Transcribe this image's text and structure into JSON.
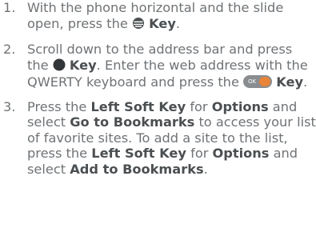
{
  "steps": [
    {
      "number": "1.",
      "parts": {
        "t1": "With the phone horizontal and the slide open, press the ",
        "k1": "Key",
        "t2": "."
      },
      "icon": "browser-globe-icon"
    },
    {
      "number": "2.",
      "parts": {
        "t1": "Scroll down to the address bar and press the ",
        "k1": "Key",
        "t2": ". Enter the web address with the QWERTY keyboard and press the ",
        "k2": "Key",
        "t3": "."
      },
      "icons": [
        "center-select-key-icon",
        "ok-enter-key-icon"
      ],
      "ok_key_text": "OK"
    },
    {
      "number": "3.",
      "parts": {
        "t1": "Press the ",
        "b1": "Left Soft Key",
        "t2": " for ",
        "b2": "Options",
        "t3": " and select ",
        "b3": "Go to Bookmarks",
        "t4": " to access your list of favorite sites. To add a site to the list, press the ",
        "b4": "Left Soft Key",
        "t5": " for ",
        "b5": "Options",
        "t6": " and select ",
        "b6": "Add to Bookmarks",
        "t7": "."
      }
    }
  ],
  "colors": {
    "body_text": "#6f7376",
    "bold_text": "#4b4f52",
    "ok_key_accent": "#e8833a"
  }
}
